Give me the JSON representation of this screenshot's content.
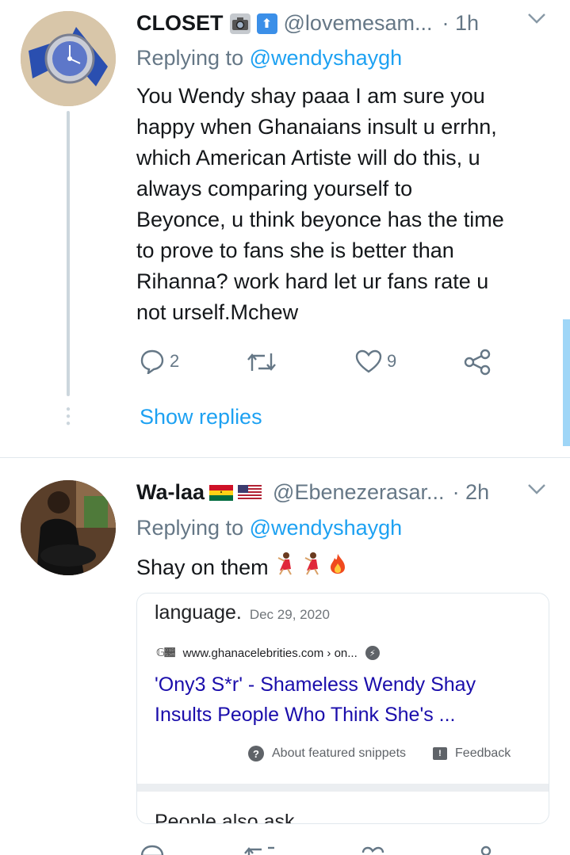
{
  "tweet1": {
    "name": "CLOSET",
    "handle": "@lovemesam...",
    "time": "· 1h",
    "replying_prefix": "Replying to",
    "replying_to": "@wendyshaygh",
    "lines": [
      "You Wendy shay paaa I am sure you",
      "happy when Ghanaians insult u errhn,",
      "which American Artiste will do this, u",
      "always comparing yourself to",
      "Beyonce, u think beyonce has the time",
      "to prove to fans she is better than",
      "Rihanna? work hard let ur fans rate u",
      "not urself.Mchew"
    ],
    "reply_count": "2",
    "like_count": "9",
    "show_replies": "Show replies"
  },
  "tweet2": {
    "name": "Wa-laa",
    "handle": "@Ebenezerasar...",
    "time": "· 2h",
    "replying_prefix": "Replying to",
    "replying_to": "@wendyshaygh",
    "text": "Shay on them",
    "card": {
      "top_word": "language.",
      "date": "Dec 29, 2020",
      "url": "www.ghanacelebrities.com › on...",
      "title_line1": "'Ony3 S*r' - Shameless Wendy Shay",
      "title_line2": "Insults People Who Think She's ...",
      "about_snippets": "About featured snippets",
      "feedback": "Feedback",
      "bottom_text": "People also ask"
    }
  },
  "colors": {
    "accent": "#1da1f2",
    "muted": "#657786",
    "google_link": "#1a0dab",
    "thread_line": "#ccd6dd"
  }
}
